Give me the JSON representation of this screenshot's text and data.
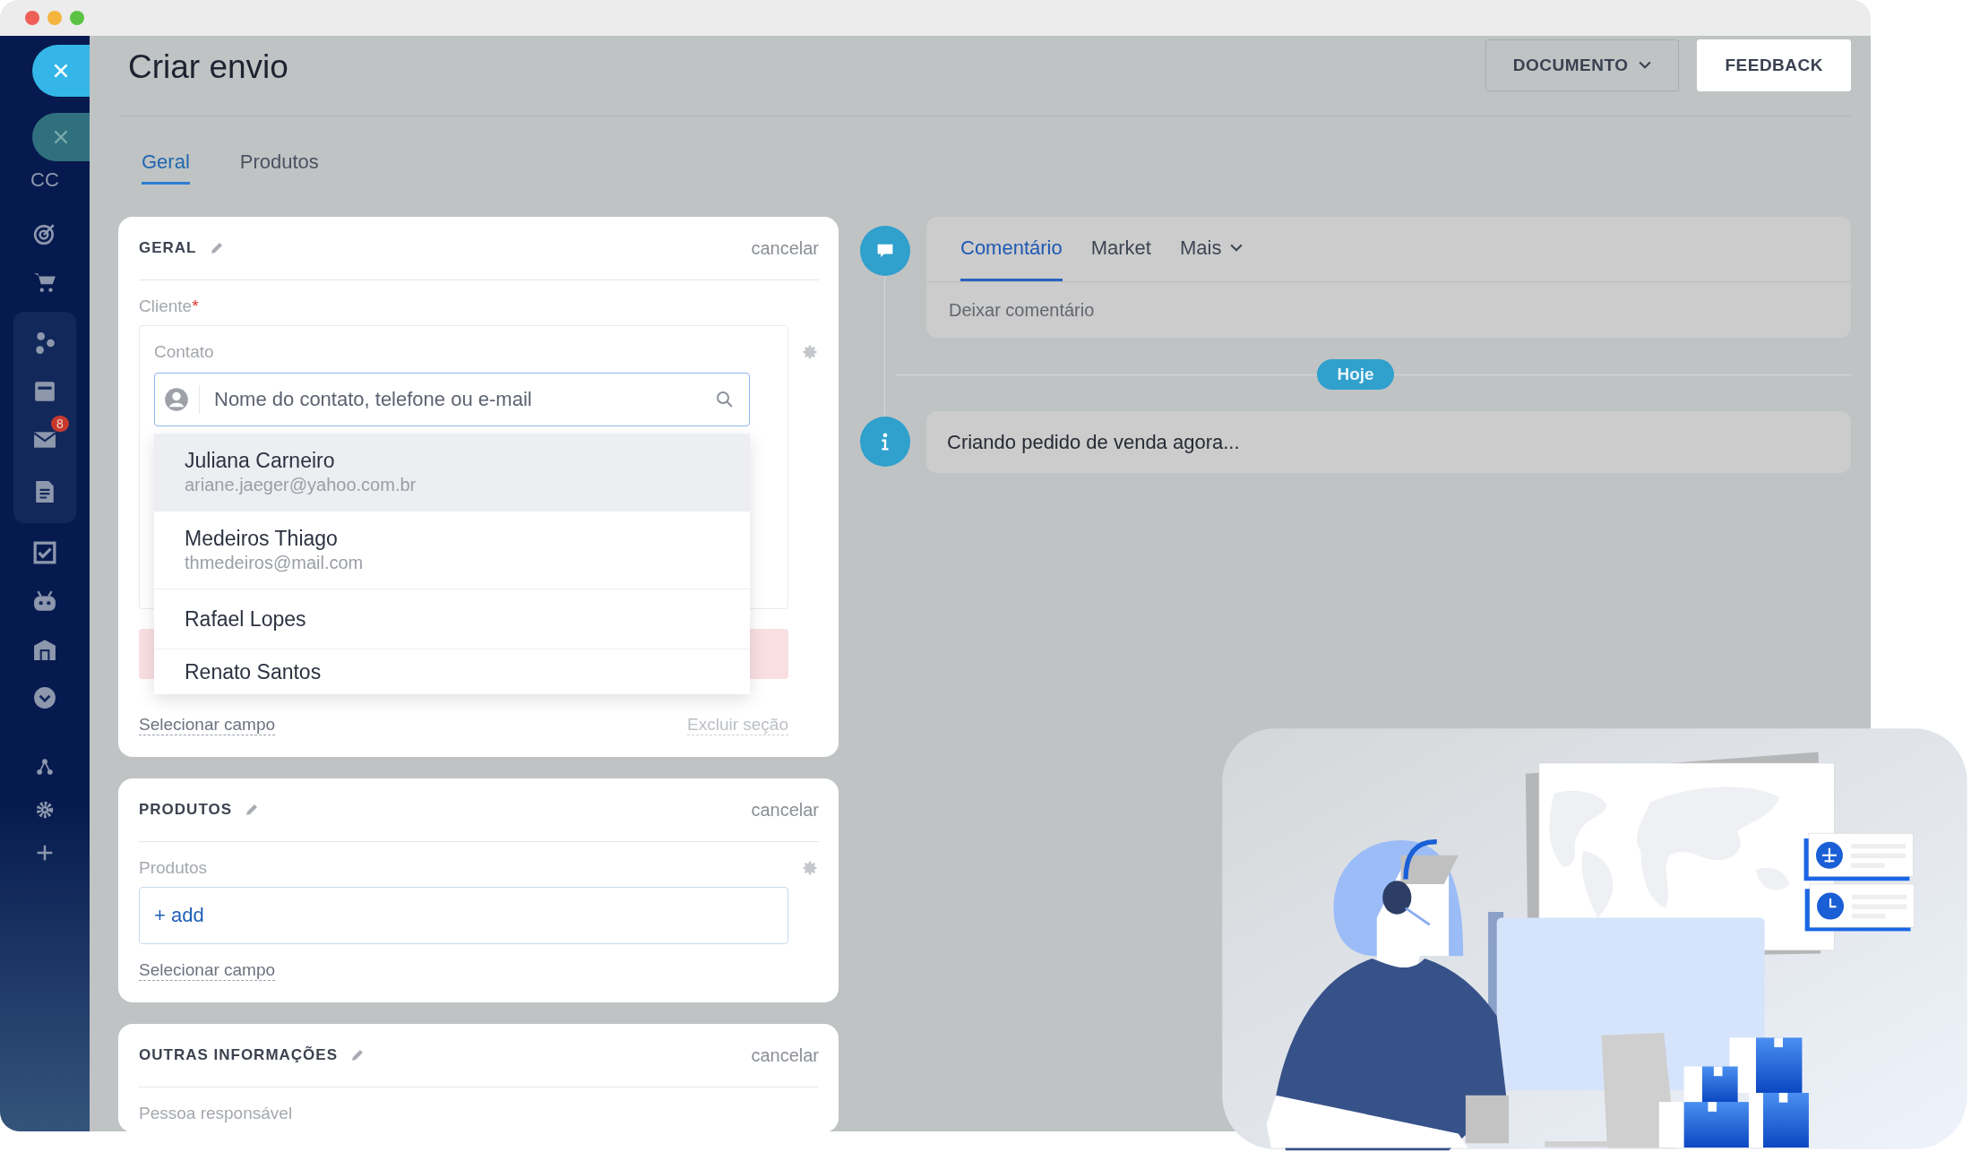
{
  "window": {
    "title": "Criar envio"
  },
  "sidebar": {
    "label": "CC",
    "badge": "8"
  },
  "header_buttons": [
    {
      "label": "DOCUMENTO",
      "kind": "dropdown"
    },
    {
      "label": "FEEDBACK",
      "kind": "primary"
    }
  ],
  "tabs": [
    {
      "label": "Geral",
      "selected": true
    },
    {
      "label": "Produtos",
      "selected": false
    }
  ],
  "geral": {
    "title": "GERAL",
    "cancel": "cancelar",
    "field_label": "Cliente",
    "required": true,
    "required_mark": "*",
    "contact_label": "Contato",
    "search": {
      "placeholder": "Nome do contato, telefone ou e-mail"
    },
    "suggestions": [
      {
        "name": "Juliana Carneiro",
        "email": "ariane.jaeger@yahoo.com.br",
        "highlighted": true
      },
      {
        "name": "Medeiros Thiago",
        "email": "thmedeiros@mail.com",
        "highlighted": false
      },
      {
        "name": "Rafael Lopes",
        "highlighted": false
      },
      {
        "name": "Renato Santos",
        "highlighted": false
      }
    ],
    "select_link": "Selecionar campo",
    "delete_link": "Excluir seção"
  },
  "produtos": {
    "title": "PRODUTOS",
    "cancel": "cancelar",
    "field_label": "Produtos",
    "add": "+ add",
    "select_link": "Selecionar campo"
  },
  "outras": {
    "title": "OUTRAS INFORMAÇÕES",
    "cancel": "cancelar",
    "field_label": "Pessoa responsável"
  },
  "feed": {
    "tabs": [
      {
        "label": "Comentário",
        "selected": true,
        "kind": "plain"
      },
      {
        "label": "Market",
        "selected": false,
        "kind": "plain"
      },
      {
        "label": "Mais",
        "selected": false,
        "kind": "dropdown"
      }
    ],
    "placeholder": "Deixar comentário",
    "date": "Hoje",
    "message": "Criando pedido de venda agora..."
  }
}
